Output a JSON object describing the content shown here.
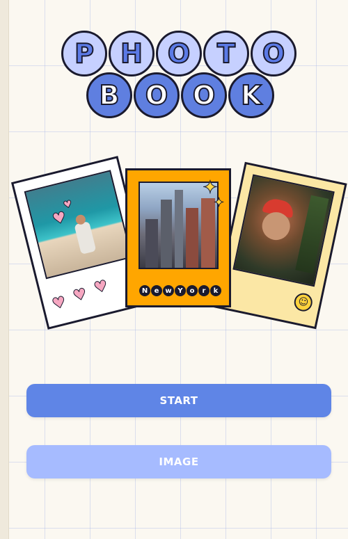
{
  "logo": {
    "top_row": [
      "P",
      "H",
      "O",
      "T",
      "O"
    ],
    "bottom_row": [
      "B",
      "O",
      "O",
      "K"
    ]
  },
  "cards": {
    "center_caption": [
      "N",
      "e",
      "w",
      "Y",
      "o",
      "r",
      "k"
    ]
  },
  "buttons": {
    "start_label": "START",
    "image_label": "IMAGE"
  },
  "colors": {
    "primary_button": "#5f85e6",
    "secondary_button": "#a6bbff",
    "center_card": "#ffa600",
    "right_card": "#fbe7a5",
    "logo_light": "#c6d0ff",
    "logo_dark": "#5f7fe0"
  },
  "icons": [
    "heart-icon",
    "sparkle-icon",
    "smiley-icon"
  ]
}
